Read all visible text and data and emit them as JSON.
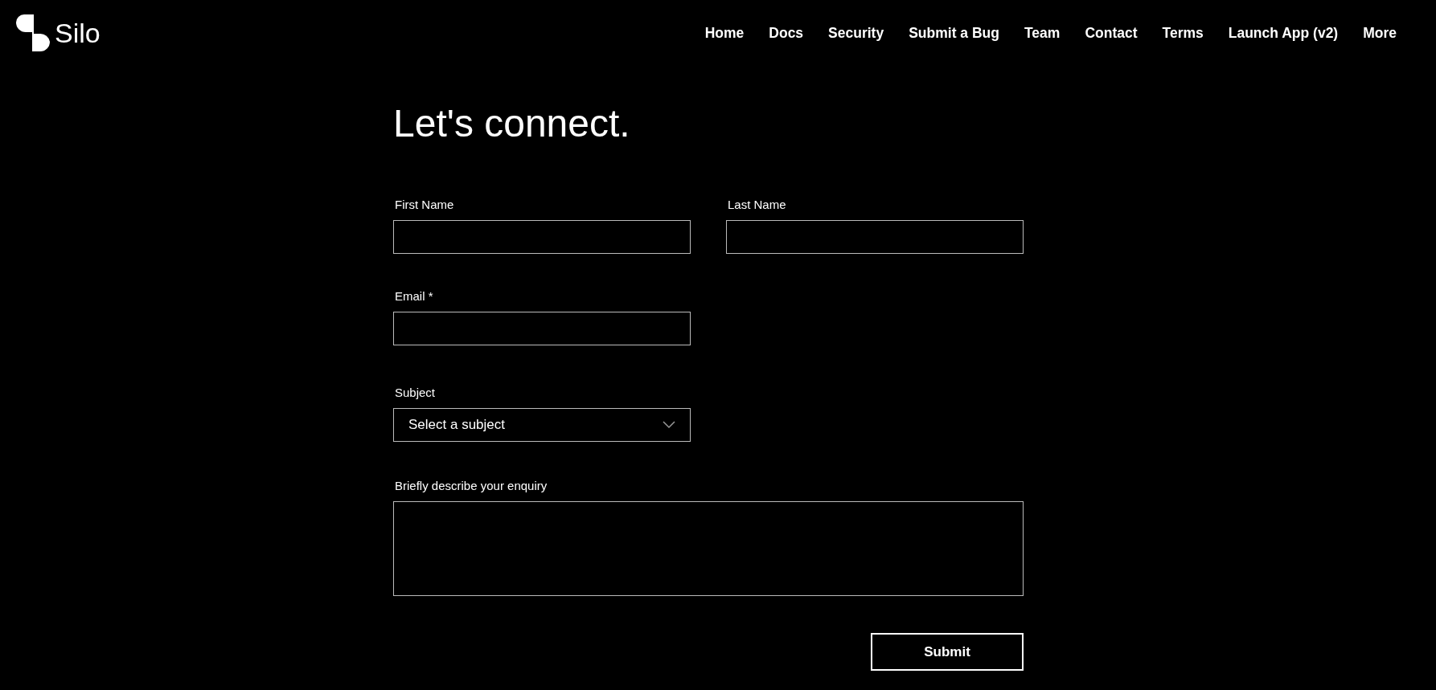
{
  "header": {
    "logo": "Silo",
    "nav": [
      {
        "label": "Home"
      },
      {
        "label": "Docs"
      },
      {
        "label": "Security"
      },
      {
        "label": "Submit a Bug"
      },
      {
        "label": "Team"
      },
      {
        "label": "Contact"
      },
      {
        "label": "Terms"
      },
      {
        "label": "Launch App (v2)"
      },
      {
        "label": "More"
      }
    ]
  },
  "title": "Let's connect.",
  "form": {
    "first_name": {
      "label": "First Name"
    },
    "last_name": {
      "label": "Last Name"
    },
    "email": {
      "label": "Email *"
    },
    "subject": {
      "label": "Subject",
      "placeholder": "Select a subject"
    },
    "enquiry": {
      "label": "Briefly describe your enquiry"
    },
    "submit": "Submit"
  }
}
